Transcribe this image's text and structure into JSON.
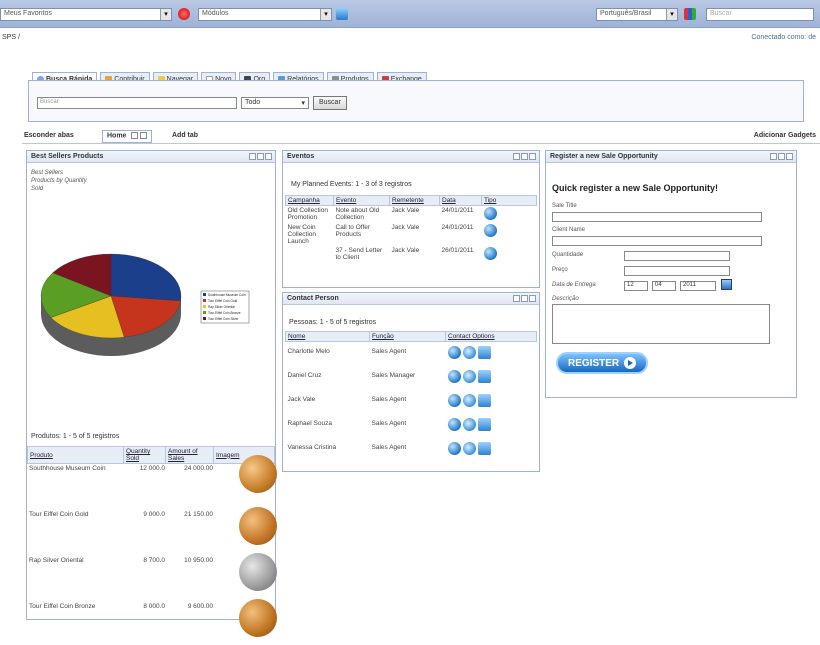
{
  "toolbar": {
    "select1_value": "Meus Favoritos",
    "select2_value": "Módulos",
    "language_value": "Português/Brasil",
    "search_placeholder": "Buscar"
  },
  "subbar": {
    "left_text": "SPS /",
    "right_text": "Conectado como: de"
  },
  "search_tabs": [
    {
      "label": "Busca Rápida",
      "active": true
    },
    {
      "label": "Contribuir"
    },
    {
      "label": "Navegar"
    },
    {
      "label": "Novo"
    },
    {
      "label": "Org"
    },
    {
      "label": "Relatórios"
    },
    {
      "label": "Produtos"
    },
    {
      "label": "Exchange"
    }
  ],
  "search": {
    "input_placeholder": "Buscar",
    "scope_value": "Todo",
    "button_label": "Buscar"
  },
  "gadget_bar": {
    "hide_tabs": "Esconder abas",
    "home_tab": "Home",
    "add_tab": "Add tab",
    "add_gadgets": "Adicionar Gadgets"
  },
  "best_sellers": {
    "title": "Best Sellers Products",
    "chart_caption": "Best Sellers\nProducts by Quantity\nSold",
    "list_caption": "Produtos: 1 - 5 of 5 registros",
    "columns": [
      "Produto",
      "Quantity Sold",
      "Amount of Sales",
      "Imagem"
    ],
    "rows": [
      {
        "produto": "Southhouse Museum Coin",
        "qty": "12 000.0",
        "amount": "24 000.00"
      },
      {
        "produto": "Tour Eiffel Coin Gold",
        "qty": "9 000.0",
        "amount": "21 150.00"
      },
      {
        "produto": "Rap Silver Oriental",
        "qty": "8 700.0",
        "amount": "10 950.00"
      },
      {
        "produto": "Tour Eiffel Coin Bronze",
        "qty": "8 000.0",
        "amount": "9 600.00"
      }
    ]
  },
  "chart_data": {
    "type": "pie",
    "title": "Best Sellers",
    "subtitle": "Products by Quantity Sold",
    "categories": [
      "Southhouse Museum Coin",
      "Tour Eiffel Coin Gold",
      "Rap Silver Oriental",
      "Tour Eiffel Coin Bronze",
      "Tour Eiffel Coin Silver"
    ],
    "values": [
      12000,
      9000,
      8700,
      8000,
      7000
    ],
    "colors": [
      "#1c3f8c",
      "#c7341d",
      "#e5c020",
      "#5a9e24",
      "#7a1420"
    ],
    "legend_position": "right"
  },
  "eventos": {
    "title": "Eventos",
    "caption": "My Planned Events: 1 - 3 of 3 registros",
    "columns": [
      "Campanha",
      "Evento",
      "Remetente",
      "Data",
      "Tipo"
    ],
    "rows": [
      {
        "campanha": "Old Collection Promotion",
        "evento": "Note about Old Collection",
        "remetente": "Jack Vale",
        "data": "24/01/2011"
      },
      {
        "campanha": "New Coin Collection Launch",
        "evento": "Call to Offer Products",
        "remetente": "Jack Vale",
        "data": "24/01/2011"
      },
      {
        "campanha": "",
        "evento": "37 - Send Letter to Client",
        "remetente": "Jack Vale",
        "data": "26/01/2011"
      }
    ]
  },
  "contact_person": {
    "title": "Contact Person",
    "caption": "Pessoas: 1 - 5 of 5 registros",
    "columns": [
      "Nome",
      "Função",
      "Contact Options"
    ],
    "rows": [
      {
        "nome": "Charlotte Melo",
        "funcao": "Sales Agent"
      },
      {
        "nome": "Daniel Cruz",
        "funcao": "Sales Manager"
      },
      {
        "nome": "Jack Vale",
        "funcao": "Sales Agent"
      },
      {
        "nome": "Raphael Souza",
        "funcao": "Sales Agent"
      },
      {
        "nome": "Vanessa Cristina",
        "funcao": "Sales Agent"
      }
    ]
  },
  "register": {
    "title": "Register a new Sale Opportunity",
    "heading": "Quick register a new Sale Opportunity!",
    "sale_title_label": "Sale Title",
    "client_name_label": "Client Name",
    "quantity_label": "Quantidade",
    "price_label": "Preço",
    "delivery_label": "Data de Entrega",
    "delivery_day": "12",
    "delivery_month": "04",
    "delivery_year": "2011",
    "description_label": "Descrição",
    "button_label": "REGISTER"
  }
}
